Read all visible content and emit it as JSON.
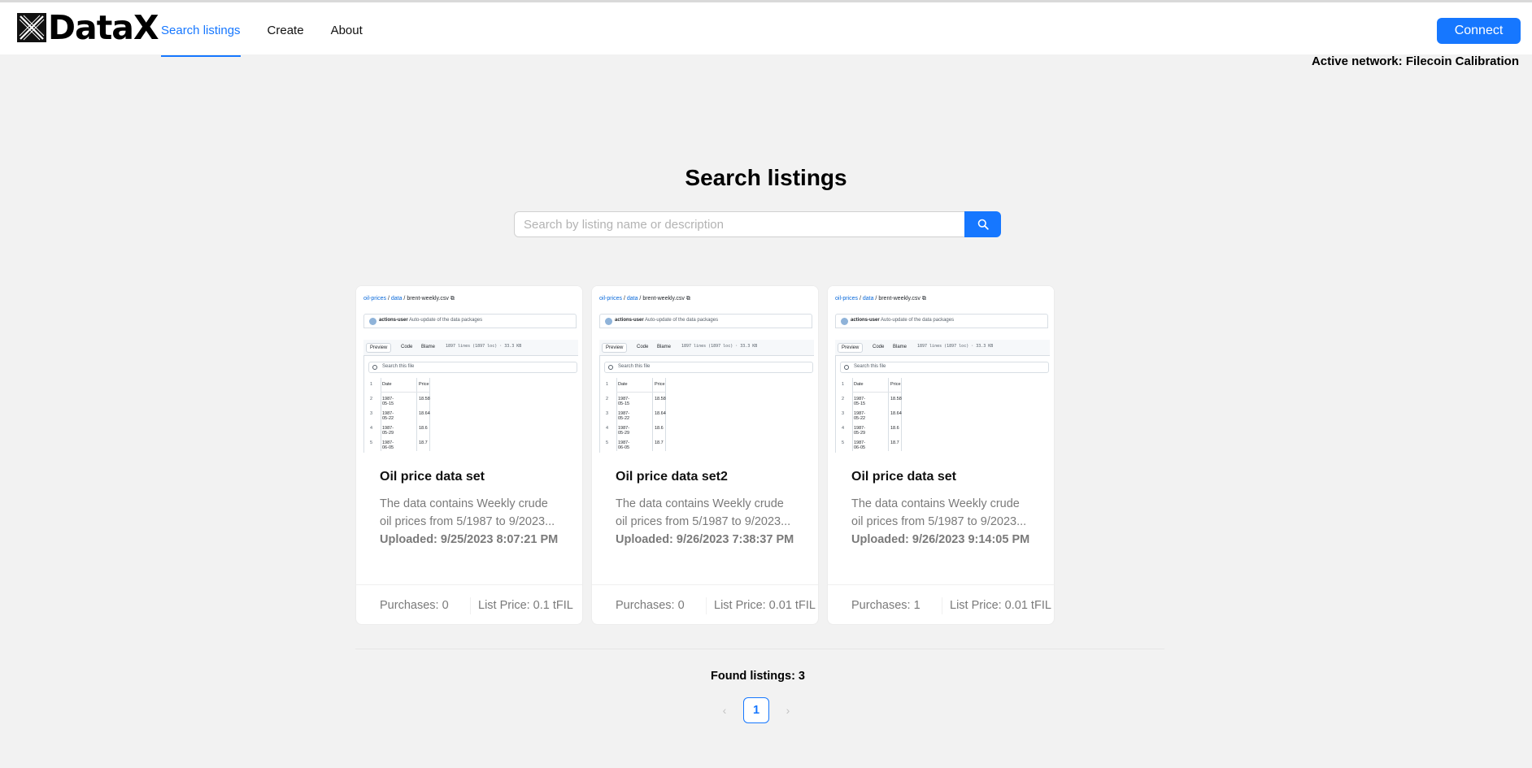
{
  "brand": {
    "name": "DataX"
  },
  "nav": [
    {
      "label": "Search listings",
      "active": true
    },
    {
      "label": "Create",
      "active": false
    },
    {
      "label": "About",
      "active": false
    }
  ],
  "connect_label": "Connect",
  "network_label": "Active network: Filecoin Calibration",
  "page_title": "Search listings",
  "search": {
    "placeholder": "Search by listing name or description",
    "value": ""
  },
  "thumbnail": {
    "crumb_repo": "oil-prices",
    "crumb_dir": "data",
    "crumb_file": "brent-weekly.csv",
    "commit_user": "actions-user",
    "commit_msg": "Auto-update of the data packages",
    "tab_preview": "Preview",
    "tab_code": "Code",
    "tab_blame": "Blame",
    "file_meta": "1897 lines (1897 loc) · 33.3 KB",
    "search_file": "Search this file",
    "rows": [
      {
        "line": "1",
        "date": "Date",
        "price": "Price"
      },
      {
        "line": "2",
        "date": "1987-05-15",
        "price": "18.58"
      },
      {
        "line": "3",
        "date": "1987-05-22",
        "price": "18.64"
      },
      {
        "line": "4",
        "date": "1987-05-29",
        "price": "18.6"
      },
      {
        "line": "5",
        "date": "1987-06-05",
        "price": "18.7"
      }
    ]
  },
  "listings": [
    {
      "title": "Oil price data set",
      "description": "The data contains Weekly crude oil prices from 5/1987 to 9/2023...",
      "uploaded": "Uploaded: 9/25/2023 8:07:21 PM",
      "purchases": "Purchases: 0",
      "price": "List Price: 0.1 tFIL"
    },
    {
      "title": "Oil price data set2",
      "description": "The data contains Weekly crude oil prices from 5/1987 to 9/2023...",
      "uploaded": "Uploaded: 9/26/2023 7:38:37 PM",
      "purchases": "Purchases: 0",
      "price": "List Price: 0.01 tFIL"
    },
    {
      "title": "Oil price data set",
      "description": "The data contains Weekly crude oil prices from 5/1987 to 9/2023...",
      "uploaded": "Uploaded: 9/26/2023 9:14:05 PM",
      "purchases": "Purchases: 1",
      "price": "List Price: 0.01 tFIL"
    }
  ],
  "found_label": "Found listings: 3",
  "pagination": {
    "current": "1",
    "prev_icon": "chevron-left-icon",
    "next_icon": "chevron-right-icon"
  },
  "colors": {
    "accent": "#1677ff",
    "background": "#f2f2f2",
    "muted_text": "#7a7a7a"
  }
}
